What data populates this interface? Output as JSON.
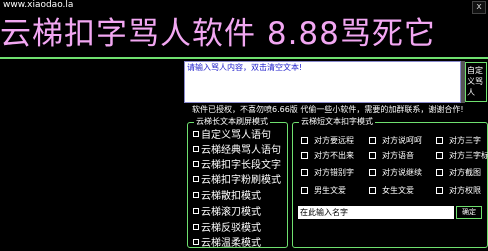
{
  "header": {
    "site_url": "www.xiaodao.la",
    "close_label": "x",
    "banner": "云梯扣字骂人软件 8.88骂死它"
  },
  "message": {
    "placeholder": "请输入骂人内容，双击清空文本!",
    "send_label": "自定义骂人"
  },
  "notice": "软件已授权，不喜勿喷6.66版    代偷一些小软件，需要的加群联系，谢谢合作!",
  "left_group": {
    "legend": "云梯长文本刷屏模式",
    "items": [
      "自定义骂人语句",
      "云梯经典骂人语句",
      "云梯扣字长段文字",
      "云梯扣字粉刷模式",
      "云梯散扣模式",
      "云梯滚刀模式",
      "云梯反驳模式",
      "云梯温柔模式"
    ]
  },
  "right_group": {
    "legend": "云梯短文本扣字模式",
    "options": [
      [
        "对方要远程",
        "对方说呵呵",
        "对方三字"
      ],
      [
        "对方不出来",
        "对方语音",
        "对方三字标"
      ],
      [
        "对方错别字",
        "对方说继续",
        "对方截图"
      ],
      [
        "男生文爱",
        "女生文爱",
        "对方权限"
      ]
    ],
    "name_placeholder": "在此输入名字",
    "confirm_label": "确定"
  },
  "colors": {
    "banner_text": "#f2a7f2",
    "accent_green": "#6fe06f",
    "background": "#000000"
  }
}
